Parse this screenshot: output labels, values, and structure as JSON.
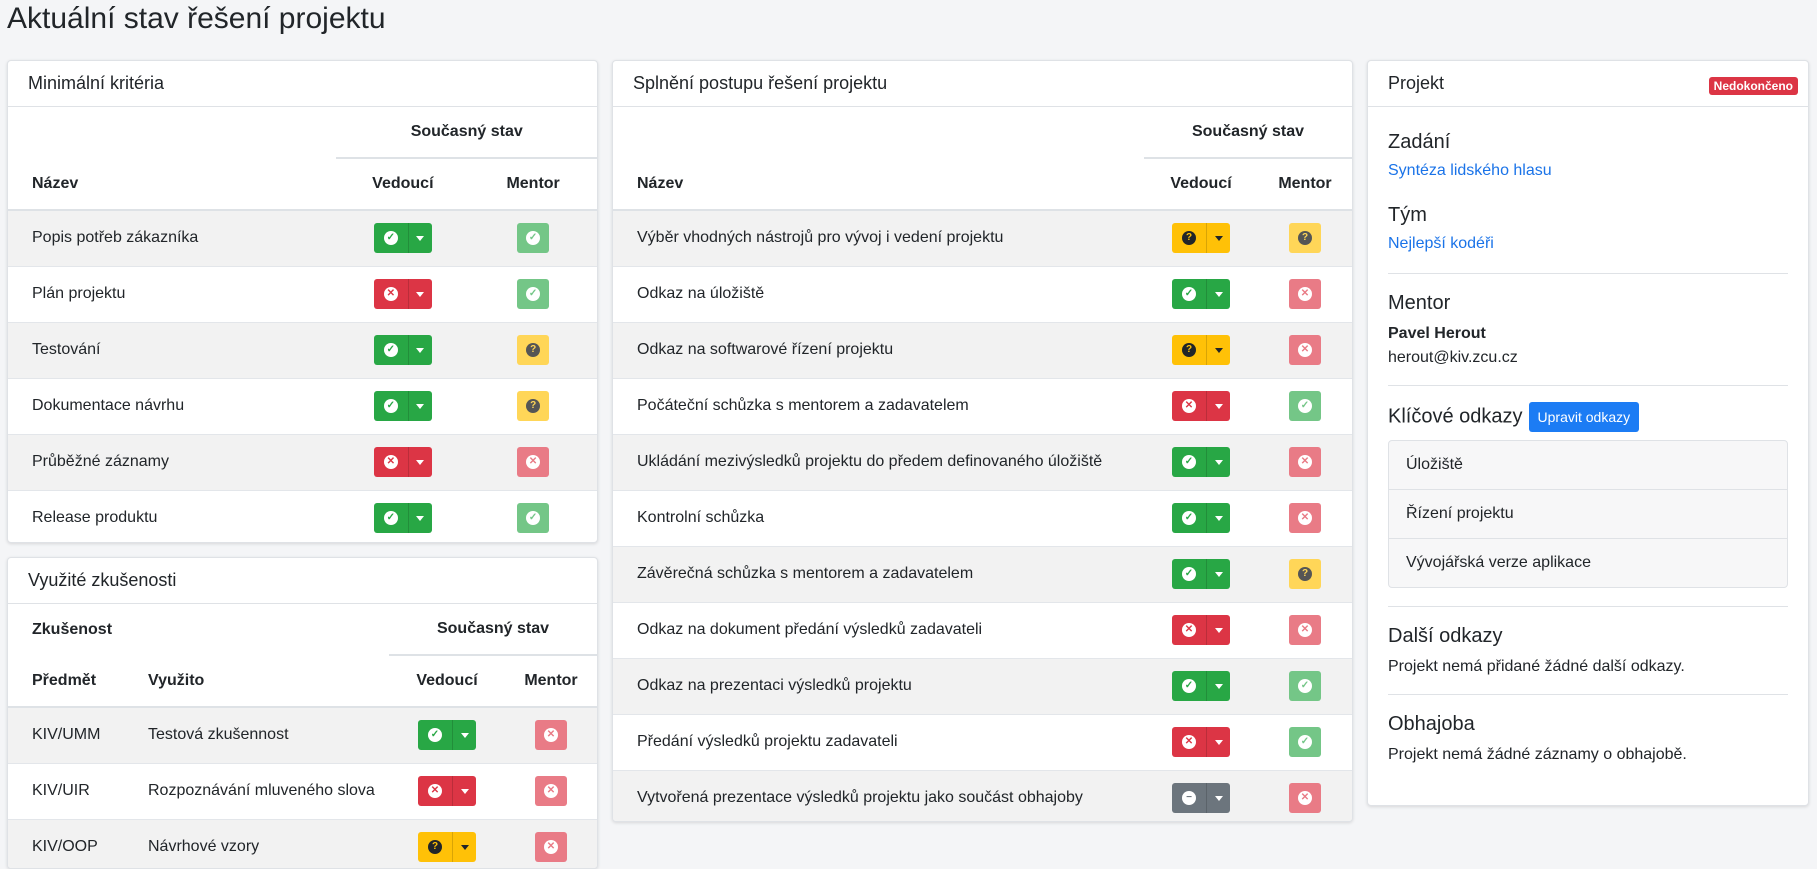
{
  "page_title": "Aktuální stav řešení projektu",
  "colors": {
    "success": "#28a745",
    "danger": "#dc3545",
    "warning": "#ffc107",
    "secondary": "#6c757d",
    "primary": "#1c7cf4"
  },
  "status_icons": {
    "ok": "check-circle-icon",
    "fail": "times-circle-icon",
    "unknown": "question-circle-icon",
    "none": "minus-circle-icon"
  },
  "min_criteria": {
    "title": "Minimální kritéria",
    "group_header": "Současný stav",
    "col_name": "Název",
    "col_lead": "Vedoucí",
    "col_mentor": "Mentor",
    "rows": [
      {
        "name": "Popis potřeb zákazníka",
        "lead": "ok",
        "mentor": "ok"
      },
      {
        "name": "Plán projektu",
        "lead": "fail",
        "mentor": "ok"
      },
      {
        "name": "Testování",
        "lead": "ok",
        "mentor": "unknown"
      },
      {
        "name": "Dokumentace návrhu",
        "lead": "ok",
        "mentor": "unknown"
      },
      {
        "name": "Průběžné záznamy",
        "lead": "fail",
        "mentor": "fail"
      },
      {
        "name": "Release produktu",
        "lead": "ok",
        "mentor": "ok"
      }
    ]
  },
  "experience": {
    "title": "Využité zkušenosti",
    "col_experience": "Zkušenost",
    "group_header": "Současný stav",
    "col_subject": "Předmět",
    "col_used": "Využito",
    "col_lead": "Vedoucí",
    "col_mentor": "Mentor",
    "rows": [
      {
        "subject": "KIV/UMM",
        "used": "Testová zkušennost",
        "lead": "ok",
        "mentor": "fail"
      },
      {
        "subject": "KIV/UIR",
        "used": "Rozpoznávání mluveného slova",
        "lead": "fail",
        "mentor": "fail"
      },
      {
        "subject": "KIV/OOP",
        "used": "Návrhové vzory",
        "lead": "unknown",
        "mentor": "fail"
      }
    ]
  },
  "progress": {
    "title": "Splnění postupu řešení projektu",
    "group_header": "Současný stav",
    "col_name": "Název",
    "col_lead": "Vedoucí",
    "col_mentor": "Mentor",
    "rows": [
      {
        "name": "Výběr vhodných nástrojů pro vývoj i vedení projektu",
        "lead": "unknown",
        "mentor": "unknown"
      },
      {
        "name": "Odkaz na úložiště",
        "lead": "ok",
        "mentor": "fail"
      },
      {
        "name": "Odkaz na softwarové řízení projektu",
        "lead": "unknown",
        "mentor": "fail"
      },
      {
        "name": "Počáteční schůzka s mentorem a zadavatelem",
        "lead": "fail",
        "mentor": "ok"
      },
      {
        "name": "Ukládání mezivýsledků projektu do předem definovaného úložiště",
        "lead": "ok",
        "mentor": "fail"
      },
      {
        "name": "Kontrolní schůzka",
        "lead": "ok",
        "mentor": "fail"
      },
      {
        "name": "Závěrečná schůzka s mentorem a zadavatelem",
        "lead": "ok",
        "mentor": "unknown"
      },
      {
        "name": "Odkaz na dokument předání výsledků zadavateli",
        "lead": "fail",
        "mentor": "fail"
      },
      {
        "name": "Odkaz na prezentaci výsledků projektu",
        "lead": "ok",
        "mentor": "ok"
      },
      {
        "name": "Předání výsledků projektu zadavateli",
        "lead": "fail",
        "mentor": "ok"
      },
      {
        "name": "Vytvořená prezentace výsledků projektu jako součást obhajoby",
        "lead": "none",
        "mentor": "fail"
      }
    ]
  },
  "project": {
    "title": "Projekt",
    "status_badge": "Nedokončeno",
    "assignment_heading": "Zadání",
    "assignment_link": "Syntéza lidského hlasu",
    "team_heading": "Tým",
    "team_link": "Nejlepší kodéři",
    "mentor_heading": "Mentor",
    "mentor_name": "Pavel Herout",
    "mentor_email": "herout@kiv.zcu.cz",
    "key_links_heading": "Klíčové odkazy",
    "edit_links_button": "Upravit odkazy",
    "key_links": [
      "Úložiště",
      "Řízení projektu",
      "Vývojářská verze aplikace"
    ],
    "other_links_heading": "Další odkazy",
    "other_links_text": "Projekt nemá přidané žádné další odkazy.",
    "defense_heading": "Obhajoba",
    "defense_text": "Projekt nemá žádné záznamy o obhajobě."
  }
}
